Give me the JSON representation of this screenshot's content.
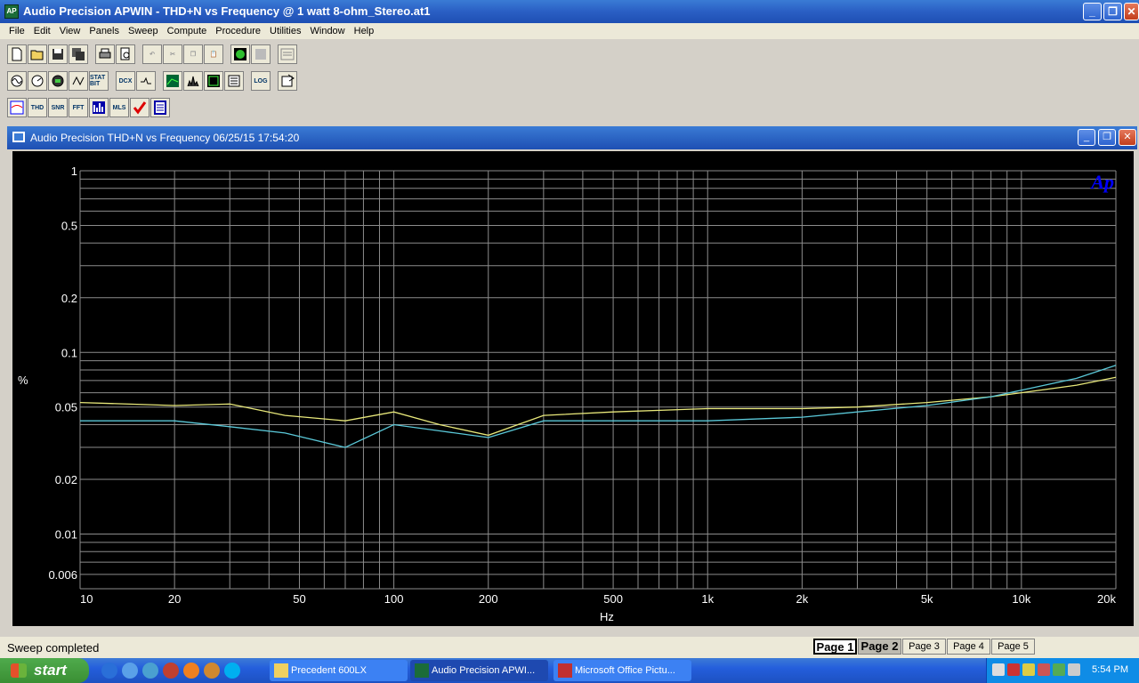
{
  "window": {
    "title": "Audio Precision APWIN - THD+N vs Frequency @ 1 watt 8-ohm_Stereo.at1",
    "app_icon": "AP"
  },
  "menu": [
    "File",
    "Edit",
    "View",
    "Panels",
    "Sweep",
    "Compute",
    "Procedure",
    "Utilities",
    "Window",
    "Help"
  ],
  "toolbar2_labels": [
    "STAT BIT",
    "DCX",
    "LOG"
  ],
  "toolbar3_labels": [
    "THD",
    "SNR",
    "FFT",
    "MLS"
  ],
  "document": {
    "title": "Audio Precision  THD+N vs Frequency  06/25/15 17:54:20"
  },
  "chart_data": {
    "type": "line",
    "logo": "Ap",
    "xlabel": "Hz",
    "ylabel": "%",
    "x_scale": "log",
    "y_scale": "log",
    "xlim": [
      10,
      20000
    ],
    "ylim": [
      0.005,
      1
    ],
    "x_ticks": [
      {
        "v": 10,
        "label": "10"
      },
      {
        "v": 20,
        "label": "20"
      },
      {
        "v": 50,
        "label": "50"
      },
      {
        "v": 100,
        "label": "100"
      },
      {
        "v": 200,
        "label": "200"
      },
      {
        "v": 500,
        "label": "500"
      },
      {
        "v": 1000,
        "label": "1k"
      },
      {
        "v": 2000,
        "label": "2k"
      },
      {
        "v": 5000,
        "label": "5k"
      },
      {
        "v": 10000,
        "label": "10k"
      },
      {
        "v": 20000,
        "label": "20k"
      }
    ],
    "y_ticks": [
      {
        "v": 1,
        "label": "1"
      },
      {
        "v": 0.5,
        "label": "0.5"
      },
      {
        "v": 0.2,
        "label": "0.2"
      },
      {
        "v": 0.1,
        "label": "0.1"
      },
      {
        "v": 0.05,
        "label": "0.05"
      },
      {
        "v": 0.02,
        "label": "0.02"
      },
      {
        "v": 0.01,
        "label": "0.01"
      },
      {
        "v": 0.006,
        "label": "0.006"
      }
    ],
    "grid": true,
    "colors": {
      "background": "#000000",
      "grid": "#8c8c8c",
      "text": "#ffffff",
      "logo": "#0000ff"
    },
    "series": [
      {
        "color": "#e8e87a",
        "points": [
          [
            10,
            0.053
          ],
          [
            20,
            0.051
          ],
          [
            30,
            0.052
          ],
          [
            45,
            0.045
          ],
          [
            70,
            0.042
          ],
          [
            100,
            0.047
          ],
          [
            140,
            0.04
          ],
          [
            200,
            0.035
          ],
          [
            300,
            0.045
          ],
          [
            500,
            0.047
          ],
          [
            1000,
            0.049
          ],
          [
            2000,
            0.049
          ],
          [
            3000,
            0.05
          ],
          [
            5000,
            0.053
          ],
          [
            8000,
            0.057
          ],
          [
            10000,
            0.06
          ],
          [
            15000,
            0.066
          ],
          [
            20000,
            0.073
          ]
        ]
      },
      {
        "color": "#5ac8d8",
        "points": [
          [
            10,
            0.042
          ],
          [
            20,
            0.042
          ],
          [
            30,
            0.039
          ],
          [
            45,
            0.036
          ],
          [
            70,
            0.03
          ],
          [
            100,
            0.04
          ],
          [
            140,
            0.037
          ],
          [
            200,
            0.034
          ],
          [
            300,
            0.042
          ],
          [
            500,
            0.042
          ],
          [
            1000,
            0.042
          ],
          [
            2000,
            0.044
          ],
          [
            3000,
            0.047
          ],
          [
            5000,
            0.051
          ],
          [
            8000,
            0.057
          ],
          [
            10000,
            0.062
          ],
          [
            15000,
            0.072
          ],
          [
            20000,
            0.085
          ]
        ]
      }
    ]
  },
  "status": {
    "text": "Sweep completed"
  },
  "pages": [
    "Page 1",
    "Page 2",
    "Page 3",
    "Page 4",
    "Page 5"
  ],
  "taskbar": {
    "start": "start",
    "tasks": [
      "Precedent 600LX",
      "Audio Precision APWI...",
      "Microsoft Office Pictu..."
    ],
    "clock": "5:54 PM"
  }
}
